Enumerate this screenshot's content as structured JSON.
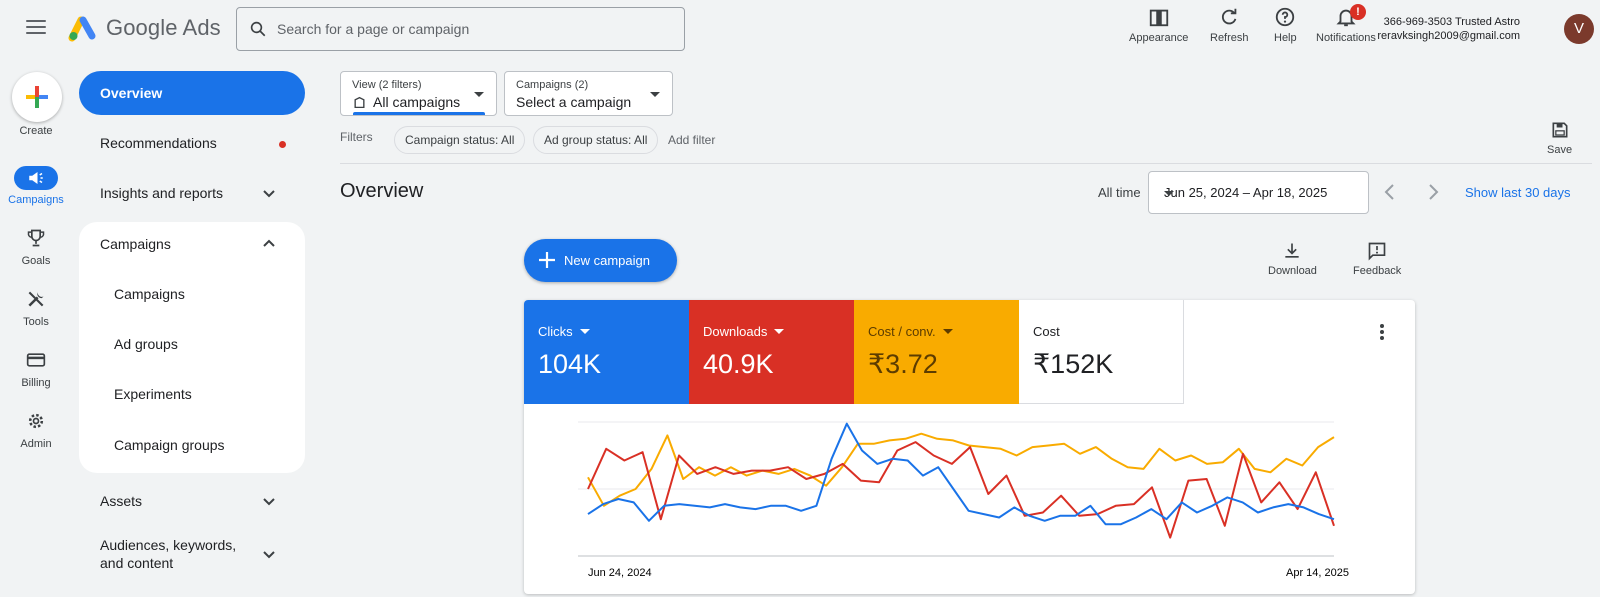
{
  "app": {
    "product_name": "Google Ads",
    "search_placeholder": "Search for a page or campaign"
  },
  "top_actions": {
    "appearance": "Appearance",
    "refresh": "Refresh",
    "help": "Help",
    "notifications": "Notifications",
    "notifications_badge": "!"
  },
  "account": {
    "line1": "366-969-3503 Trusted Astro",
    "line2": "reravksingh2009@gmail.com",
    "avatar_initial": "V"
  },
  "rail": {
    "create": "Create",
    "campaigns": "Campaigns",
    "goals": "Goals",
    "tools": "Tools",
    "billing": "Billing",
    "admin": "Admin"
  },
  "nav": {
    "overview": "Overview",
    "recommendations": "Recommendations",
    "insights": "Insights and reports",
    "campaigns_group": "Campaigns",
    "sub": [
      "Campaigns",
      "Ad groups",
      "Experiments",
      "Campaign groups"
    ],
    "assets": "Assets",
    "audiences": "Audiences, keywords, and content"
  },
  "filters": {
    "view_label": "View (2 filters)",
    "view_value": "All campaigns",
    "campaigns_label": "Campaigns (2)",
    "campaigns_value": "Select a campaign",
    "filters_label": "Filters",
    "chip_campaign_status": "Campaign status: All",
    "chip_adgroup_status": "Ad group status: All",
    "add_filter": "Add filter",
    "save": "Save"
  },
  "overview": {
    "title": "Overview",
    "range_label": "All time",
    "date_range": "Jun 25, 2024 – Apr 18, 2025",
    "show_last": "Show last 30 days",
    "new_campaign": "New campaign",
    "download": "Download",
    "feedback": "Feedback"
  },
  "metrics": [
    {
      "name": "Clicks",
      "value": "104K",
      "color": "#1a73e8"
    },
    {
      "name": "Downloads",
      "value": "40.9K",
      "color": "#d93025"
    },
    {
      "name": "Cost / conv.",
      "value": "₹3.72",
      "color": "#f9ab00"
    },
    {
      "name": "Cost",
      "value": "₹152K",
      "color": "#ffffff"
    }
  ],
  "chart_data": {
    "type": "line",
    "x_start_label": "Jun 24, 2024",
    "x_end_label": "Apr 14, 2025",
    "series": [
      {
        "name": "Cost / conv.",
        "color": "#f9ab00",
        "values": [
          47,
          30,
          36,
          40,
          52,
          72,
          46,
          53,
          48,
          53,
          48,
          51,
          49,
          52,
          48,
          42,
          53,
          67,
          67,
          69,
          70,
          73,
          70,
          69,
          66,
          65,
          64,
          60,
          65,
          66,
          67,
          61,
          65,
          58,
          53,
          52,
          64,
          57,
          60,
          55,
          56,
          64,
          52,
          50,
          58,
          54,
          65,
          71
        ]
      },
      {
        "name": "Downloads",
        "color": "#d93025",
        "values": [
          40,
          64,
          57,
          62,
          22,
          60,
          49,
          53,
          49,
          51,
          51,
          53,
          46,
          49,
          55,
          45,
          44,
          63,
          68,
          60,
          55,
          65,
          37,
          48,
          24,
          26,
          36,
          24,
          25,
          30,
          31,
          41,
          11,
          45,
          46,
          18,
          61,
          32,
          44,
          28,
          50,
          18
        ]
      },
      {
        "name": "Clicks",
        "color": "#1a73e8",
        "values": [
          25,
          31,
          34,
          32,
          21,
          30,
          31,
          30,
          29,
          31,
          29,
          28,
          30,
          30,
          27,
          30,
          58,
          79,
          63,
          55,
          58,
          57,
          48,
          53,
          40,
          27,
          25,
          23,
          29,
          24,
          21,
          24,
          24,
          30,
          19,
          19,
          23,
          28,
          22,
          32,
          26,
          30,
          35,
          32,
          26,
          29,
          31,
          29,
          25,
          22
        ]
      }
    ]
  }
}
